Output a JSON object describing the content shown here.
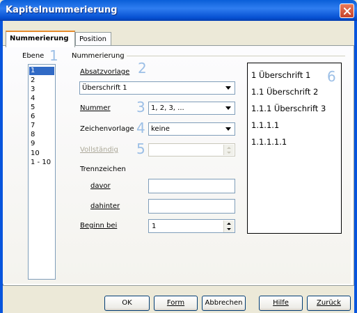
{
  "window": {
    "title": "Kapitelnummerierung"
  },
  "tabs": [
    {
      "label": "Nummerierung",
      "active": true
    },
    {
      "label": "Position",
      "active": false
    }
  ],
  "ebene": {
    "label": "Ebene",
    "items": [
      "1",
      "2",
      "3",
      "4",
      "5",
      "6",
      "7",
      "8",
      "9",
      "10",
      "1 - 10"
    ],
    "selected": "1"
  },
  "nummerierung": {
    "group_label": "Nummerierung",
    "absatzvorlage": {
      "label": "Absatzvorlage",
      "value": "Überschrift 1"
    },
    "nummer": {
      "label": "Nummer",
      "value": "1, 2, 3, ..."
    },
    "zeichenvorlage": {
      "label": "Zeichenvorlage",
      "value": "keine"
    },
    "vollstaendig": {
      "label": "Vollständig",
      "value": ""
    },
    "trennzeichen": {
      "label": "Trennzeichen",
      "davor": {
        "label": "davor",
        "value": ""
      },
      "dahinter": {
        "label": "dahinter",
        "value": ""
      }
    },
    "beginn_bei": {
      "label": "Beginn bei",
      "value": "1"
    }
  },
  "preview": {
    "lines": [
      "1 Überschrift 1",
      "1.1 Überschrift 2",
      "1.1.1 Überschrift 3",
      "1.1.1.1",
      "1.1.1.1.1"
    ]
  },
  "callouts": [
    "1",
    "2",
    "3",
    "4",
    "5",
    "6"
  ],
  "buttons": {
    "ok": "OK",
    "form": "Form",
    "abbrechen": "Abbrechen",
    "hilfe": "Hilfe",
    "zurueck": "Zurück"
  },
  "colors": {
    "titlebar": "#0a5fd8",
    "selection": "#316ac5",
    "callout": "#9cbfe6"
  }
}
